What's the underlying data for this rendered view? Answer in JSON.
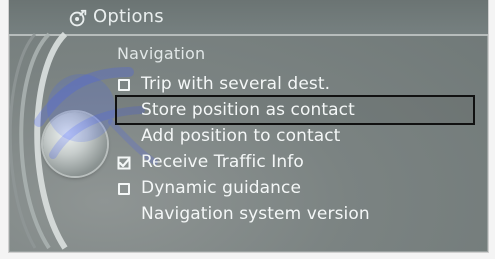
{
  "header": {
    "icon": "options-gear-icon",
    "title": "Options"
  },
  "menu": {
    "section_title": "Navigation",
    "items": [
      {
        "label": "Trip with several dest.",
        "control": "checkbox",
        "checked": false,
        "selected": false
      },
      {
        "label": "Store position as contact",
        "control": "none",
        "checked": null,
        "selected": true
      },
      {
        "label": "Add position to contact",
        "control": "none",
        "checked": null,
        "selected": false
      },
      {
        "label": "Receive Traffic Info",
        "control": "checkbox",
        "checked": true,
        "selected": false
      },
      {
        "label": "Dynamic guidance",
        "control": "checkbox",
        "checked": false,
        "selected": false
      },
      {
        "label": "Navigation system version",
        "control": "none",
        "checked": null,
        "selected": false
      }
    ]
  },
  "colors": {
    "screen": "#7b8382",
    "text": "#f4f7f7",
    "selection_border": "#111111"
  }
}
